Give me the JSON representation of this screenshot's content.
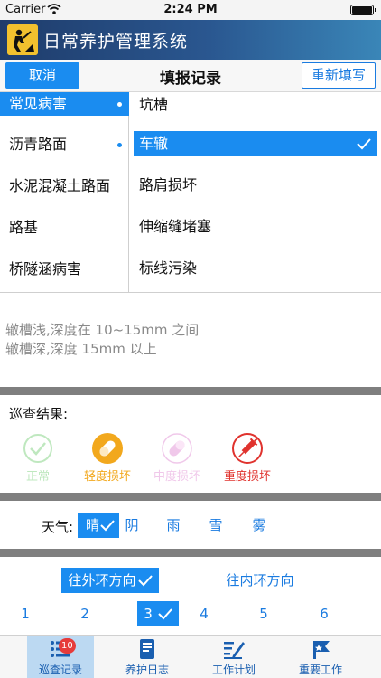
{
  "status_bar": {
    "carrier": "Carrier",
    "time": "2:24 PM"
  },
  "app": {
    "title": "日常养护管理系统"
  },
  "nav": {
    "cancel_label": "取消",
    "title": "填报记录",
    "refill_label": "重新填写"
  },
  "categories": [
    {
      "label": "常见病害",
      "selected": true
    },
    {
      "label": "沥青路面",
      "selected": false
    },
    {
      "label": "水泥混凝土路面",
      "selected": false
    },
    {
      "label": "路基",
      "selected": false
    },
    {
      "label": "桥隧涵病害",
      "selected": false
    }
  ],
  "subcategories": [
    {
      "label": "坑槽",
      "selected": false
    },
    {
      "label": "车辙",
      "selected": true
    },
    {
      "label": "路肩损坏",
      "selected": false
    },
    {
      "label": "伸缩缝堵塞",
      "selected": false
    },
    {
      "label": "标线污染",
      "selected": false
    }
  ],
  "description": {
    "line1": "辙槽浅,深度在 10~15mm 之间",
    "line2": "辙槽深,深度 15mm 以上"
  },
  "inspection": {
    "label": "巡查结果:",
    "options": [
      {
        "label": "正常",
        "icon": "check-circle-icon",
        "color": "#bfe8bf"
      },
      {
        "label": "轻度损坏",
        "icon": "pill-icon",
        "color": "#f2a81d"
      },
      {
        "label": "中度损坏",
        "icon": "pill-icon",
        "color": "#f0c8ea"
      },
      {
        "label": "重度损坏",
        "icon": "syringe-icon",
        "color": "#e0332e"
      }
    ]
  },
  "weather": {
    "label": "天气:",
    "options": [
      "晴",
      "阴",
      "雨",
      "雪",
      "雾"
    ],
    "selected": "晴"
  },
  "direction": {
    "options": [
      "往外环方向",
      "往内环方向"
    ],
    "selected": "往外环方向"
  },
  "numbers": {
    "options": [
      "1",
      "2",
      "3",
      "4",
      "5",
      "6"
    ],
    "selected": "3"
  },
  "tabs": [
    {
      "label": "巡查记录",
      "icon": "list-icon",
      "badge": "10",
      "active": true
    },
    {
      "label": "养护日志",
      "icon": "book-icon",
      "active": false
    },
    {
      "label": "工作计划",
      "icon": "pencil-list-icon",
      "active": false
    },
    {
      "label": "重要工作",
      "icon": "flag-icon",
      "active": false
    }
  ],
  "colors": {
    "accent": "#1a8cf0",
    "banner": "#2a5790",
    "divider": "#7f7f7f"
  }
}
